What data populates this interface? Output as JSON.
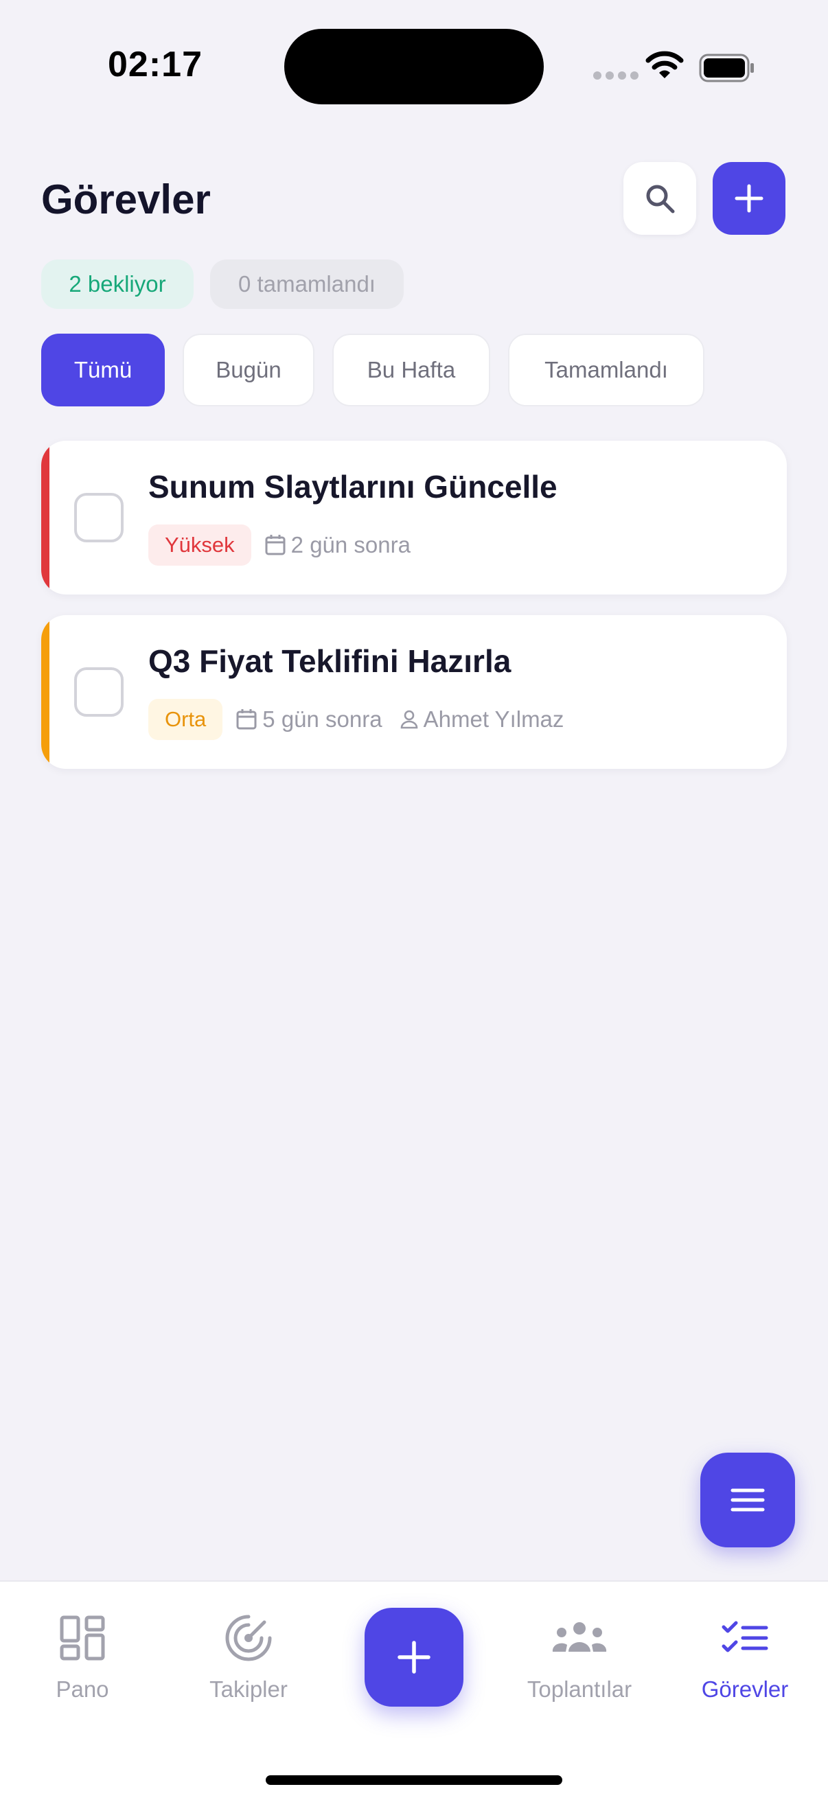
{
  "status_bar": {
    "time": "02:17"
  },
  "header": {
    "title": "Görevler"
  },
  "stats": {
    "pending": "2 bekliyor",
    "completed": "0 tamamlandı"
  },
  "filters": [
    {
      "label": "Tümü",
      "active": true
    },
    {
      "label": "Bugün",
      "active": false
    },
    {
      "label": "Bu Hafta",
      "active": false
    },
    {
      "label": "Tamamlandı",
      "active": false
    }
  ],
  "tasks": [
    {
      "title": "Sunum Slaytlarını Güncelle",
      "priority": "Yüksek",
      "priority_color": "#e0373c",
      "due": "2 gün sonra"
    },
    {
      "title": "Q3 Fiyat Teklifini Hazırla",
      "priority": "Orta",
      "priority_color": "#f59e0b",
      "due": "5 gün sonra",
      "assignee": "Ahmet Yılmaz"
    }
  ],
  "nav": {
    "items": [
      {
        "label": "Pano",
        "icon": "dashboard-icon"
      },
      {
        "label": "Takipler",
        "icon": "radar-icon"
      },
      {
        "label": "Toplantılar",
        "icon": "people-icon"
      },
      {
        "label": "Görevler",
        "icon": "tasks-icon",
        "active": true
      }
    ]
  },
  "colors": {
    "accent": "#4f46e5",
    "high": "#e0373c",
    "medium": "#f59e0b",
    "background": "#f3f2f8"
  }
}
